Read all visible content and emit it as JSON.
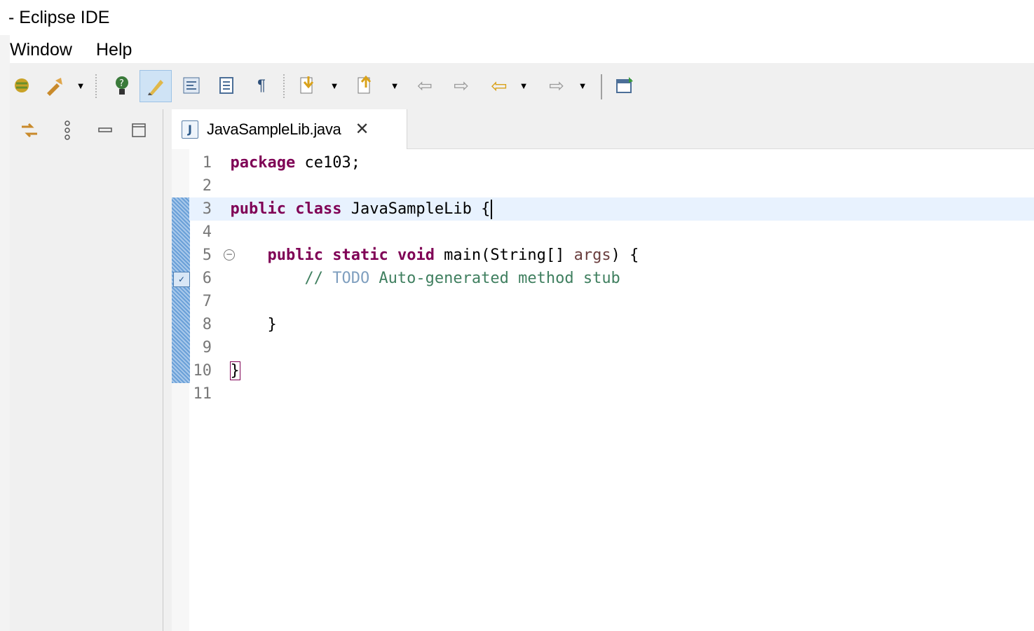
{
  "window": {
    "title": "- Eclipse IDE"
  },
  "menu": [
    "Window",
    "Help"
  ],
  "toolbar": {
    "icons": [
      "debug-run-icon",
      "external-tools-icon",
      "dropdown-arrow",
      "help-tip-icon",
      "highlight-icon",
      "toggle-breadcrumb-icon",
      "block-selection-icon",
      "show-whitespace-icon",
      "next-annotation-icon",
      "prev-annotation-icon",
      "back-icon",
      "forward-icon",
      "last-edit-icon",
      "open-perspective-icon"
    ]
  },
  "editor": {
    "tab": {
      "label": "JavaSampleLib.java",
      "close": "✕",
      "icon": "J"
    },
    "lines": [
      {
        "num": "1",
        "parts": [
          [
            "kw",
            "package"
          ],
          [
            "t",
            " ce103;"
          ]
        ]
      },
      {
        "num": "2",
        "parts": []
      },
      {
        "num": "3",
        "parts": [
          [
            "kw",
            "public"
          ],
          [
            "t",
            " "
          ],
          [
            "kw",
            "class"
          ],
          [
            "t",
            " JavaSampleLib {"
          ]
        ]
      },
      {
        "num": "4",
        "parts": []
      },
      {
        "num": "5",
        "parts": [
          [
            "t",
            "    "
          ],
          [
            "kw",
            "public"
          ],
          [
            "t",
            " "
          ],
          [
            "kw",
            "static"
          ],
          [
            "t",
            " "
          ],
          [
            "kw",
            "void"
          ],
          [
            "t",
            " main(String[] "
          ],
          [
            "param",
            "args"
          ],
          [
            "t",
            ") {"
          ]
        ]
      },
      {
        "num": "6",
        "parts": [
          [
            "cm",
            "        // "
          ],
          [
            "todo",
            "TODO"
          ],
          [
            "cm",
            " Auto-generated method stub"
          ]
        ]
      },
      {
        "num": "7",
        "parts": []
      },
      {
        "num": "8",
        "parts": [
          [
            "t",
            "    }"
          ]
        ]
      },
      {
        "num": "9",
        "parts": []
      },
      {
        "num": "10",
        "parts": [
          [
            "t",
            "}"
          ]
        ]
      },
      {
        "num": "11",
        "parts": []
      }
    ]
  }
}
